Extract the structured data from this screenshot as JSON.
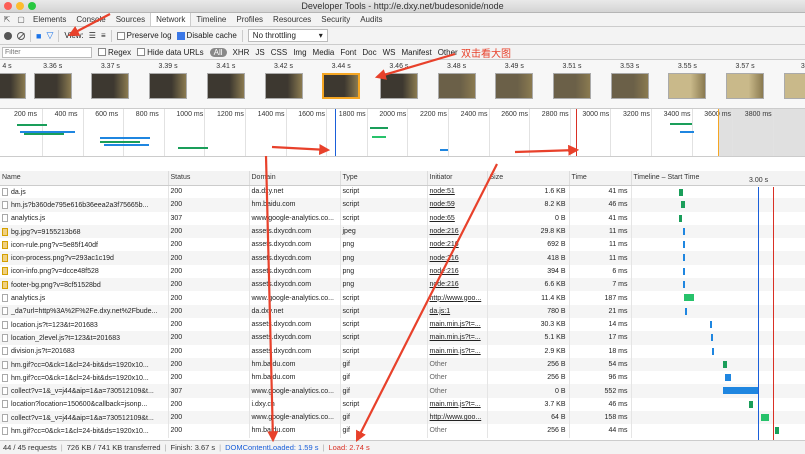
{
  "window": {
    "title": "Developer Tools - http://e.dxy.net/budesonide/node"
  },
  "tabs": [
    "Elements",
    "Console",
    "Sources",
    "Network",
    "Timeline",
    "Profiles",
    "Resources",
    "Security",
    "Audits"
  ],
  "active_tab": "Network",
  "toolbar": {
    "view_label": "View:",
    "preserve_log": "Preserve log",
    "disable_cache": "Disable cache",
    "throttling": "No throttling"
  },
  "filterbar": {
    "placeholder": "Filter",
    "regex": "Regex",
    "hide_data_urls": "Hide data URLs",
    "types": [
      "All",
      "XHR",
      "JS",
      "CSS",
      "Img",
      "Media",
      "Font",
      "Doc",
      "WS",
      "Manifest",
      "Other"
    ]
  },
  "filmstrip": [
    "4 s",
    "3.36 s",
    "3.37 s",
    "3.39 s",
    "3.41 s",
    "3.42 s",
    "3.44 s",
    "3.46 s",
    "3.48 s",
    "3.49 s",
    "3.51 s",
    "3.53 s",
    "3.55 s",
    "3.57 s",
    "3"
  ],
  "overview_ticks": [
    "200 ms",
    "400 ms",
    "600 ms",
    "800 ms",
    "1000 ms",
    "1200 ms",
    "1400 ms",
    "1600 ms",
    "1800 ms",
    "2000 ms",
    "2200 ms",
    "2400 ms",
    "2600 ms",
    "2800 ms",
    "3000 ms",
    "3200 ms",
    "3400 ms",
    "3600 ms",
    "3800 ms"
  ],
  "columns": [
    "Name",
    "Status",
    "Domain",
    "Type",
    "Initiator",
    "Size",
    "Time",
    "Timeline – Start Time"
  ],
  "timeline_marker": "3.00 s",
  "rows": [
    {
      "name": "da.js",
      "status": "200",
      "domain": "da.dxy.net",
      "type": "script",
      "initiator": "node:51",
      "size": "1.6 KB",
      "time": "41 ms",
      "icon": "doc"
    },
    {
      "name": "hm.js?b360de795e616b36eea2a3f75665b...",
      "status": "200",
      "domain": "hm.baidu.com",
      "type": "script",
      "initiator": "node:59",
      "size": "8.2 KB",
      "time": "46 ms",
      "icon": "doc"
    },
    {
      "name": "analytics.js",
      "status": "307",
      "domain": "www.google-analytics.co...",
      "type": "script",
      "initiator": "node:65",
      "size": "0 B",
      "time": "41 ms",
      "icon": "doc"
    },
    {
      "name": "bg.jpg?v=9155213b68",
      "status": "200",
      "domain": "assets.dxycdn.com",
      "type": "jpeg",
      "initiator": "node:216",
      "size": "29.8 KB",
      "time": "11 ms",
      "icon": "img"
    },
    {
      "name": "icon-rule.png?v=5e85f140df",
      "status": "200",
      "domain": "assets.dxycdn.com",
      "type": "png",
      "initiator": "node:216",
      "size": "692 B",
      "time": "11 ms",
      "icon": "img"
    },
    {
      "name": "icon-process.png?v=293ac1c19d",
      "status": "200",
      "domain": "assets.dxycdn.com",
      "type": "png",
      "initiator": "node:216",
      "size": "418 B",
      "time": "11 ms",
      "icon": "img"
    },
    {
      "name": "icon-info.png?v=dcce48f528",
      "status": "200",
      "domain": "assets.dxycdn.com",
      "type": "png",
      "initiator": "node:216",
      "size": "394 B",
      "time": "6 ms",
      "icon": "img"
    },
    {
      "name": "footer-bg.png?v=8cf51528bd",
      "status": "200",
      "domain": "assets.dxycdn.com",
      "type": "png",
      "initiator": "node:216",
      "size": "6.6 KB",
      "time": "7 ms",
      "icon": "img"
    },
    {
      "name": "analytics.js",
      "status": "200",
      "domain": "www.google-analytics.co...",
      "type": "script",
      "initiator": "http://www.goo...",
      "size": "11.4 KB",
      "time": "187 ms",
      "icon": "doc"
    },
    {
      "name": "_da?url=http%3A%2F%2Fe.dxy.net%2Fbude...",
      "status": "200",
      "domain": "da.dxy.net",
      "type": "script",
      "initiator": "da.js:1",
      "size": "780 B",
      "time": "21 ms",
      "icon": "doc"
    },
    {
      "name": "location.js?t=123&t=201683",
      "status": "200",
      "domain": "assets.dxycdn.com",
      "type": "script",
      "initiator": "main.min.js?t=...",
      "size": "30.3 KB",
      "time": "14 ms",
      "icon": "doc"
    },
    {
      "name": "location_2level.js?t=123&t=201683",
      "status": "200",
      "domain": "assets.dxycdn.com",
      "type": "script",
      "initiator": "main.min.js?t=...",
      "size": "5.1 KB",
      "time": "17 ms",
      "icon": "doc"
    },
    {
      "name": "division.js?t=201683",
      "status": "200",
      "domain": "assets.dxycdn.com",
      "type": "script",
      "initiator": "main.min.js?t=...",
      "size": "2.9 KB",
      "time": "18 ms",
      "icon": "doc"
    },
    {
      "name": "hm.gif?cc=0&ck=1&cl=24-bit&ds=1920x10...",
      "status": "200",
      "domain": "hm.baidu.com",
      "type": "gif",
      "initiator": "Other",
      "size": "256 B",
      "time": "54 ms",
      "icon": "doc"
    },
    {
      "name": "hm.gif?cc=0&ck=1&cl=24-bit&ds=1920x10...",
      "status": "200",
      "domain": "hm.baidu.com",
      "type": "gif",
      "initiator": "Other",
      "size": "256 B",
      "time": "96 ms",
      "icon": "doc"
    },
    {
      "name": "collect?v=1&_v=j44&aip=1&a=730512109&t...",
      "status": "307",
      "domain": "www.google-analytics.co...",
      "type": "gif",
      "initiator": "Other",
      "size": "0 B",
      "time": "552 ms",
      "icon": "doc"
    },
    {
      "name": "location?location=150600&callback=jsonp...",
      "status": "200",
      "domain": "i.dxy.cn",
      "type": "script",
      "initiator": "main.min.js?t=...",
      "size": "3.7 KB",
      "time": "46 ms",
      "icon": "doc"
    },
    {
      "name": "collect?v=1&_v=j44&aip=1&a=730512109&t...",
      "status": "200",
      "domain": "www.google-analytics.co...",
      "type": "gif",
      "initiator": "http://www.goo...",
      "size": "64 B",
      "time": "158 ms",
      "icon": "doc"
    },
    {
      "name": "hm.gif?cc=0&ck=1&cl=24-bit&ds=1920x10...",
      "status": "200",
      "domain": "hm.baidu.com",
      "type": "gif",
      "initiator": "Other",
      "size": "256 B",
      "time": "44 ms",
      "icon": "doc"
    }
  ],
  "status": {
    "requests": "44 / 45 requests",
    "transferred": "726 KB / 741 KB transferred",
    "finish": "Finish: 3.67 s",
    "dcl": "DOMContentLoaded: 1.59 s",
    "load": "Load: 2.74 s"
  },
  "annotation": "双击看大图",
  "colors": {
    "annotation": "#e8412b",
    "dcl": "#1a5fd9",
    "load": "#d93025",
    "selected_frame": "#f5a623"
  }
}
